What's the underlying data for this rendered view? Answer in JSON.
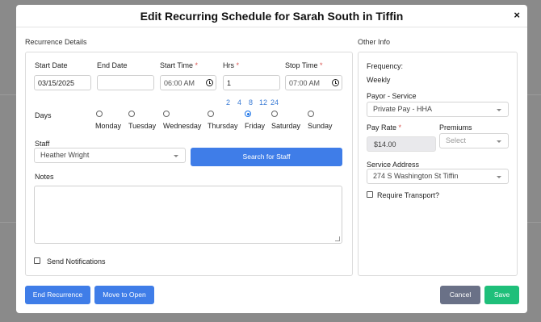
{
  "modal": {
    "title": "Edit Recurring Schedule for Sarah South in Tiffin",
    "close_label": "×"
  },
  "recurrence": {
    "section_title": "Recurrence Details",
    "start_date_label": "Start Date",
    "start_date_value": "03/15/2025",
    "end_date_label": "End Date",
    "end_date_value": "",
    "start_time_label": "Start Time",
    "start_time_value": "06:00 AM",
    "hrs_label": "Hrs",
    "hrs_value": "1",
    "stop_time_label": "Stop Time",
    "stop_time_value": "07:00 AM",
    "required_mark": "*",
    "quick_hours": [
      "2",
      "4",
      "8",
      "12",
      "24"
    ],
    "days_label": "Days",
    "days": [
      {
        "label": "Monday",
        "checked": false
      },
      {
        "label": "Tuesday",
        "checked": false
      },
      {
        "label": "Wednesday",
        "checked": false
      },
      {
        "label": "Thursday",
        "checked": false
      },
      {
        "label": "Friday",
        "checked": true
      },
      {
        "label": "Saturday",
        "checked": false
      },
      {
        "label": "Sunday",
        "checked": false
      }
    ],
    "staff_label": "Staff",
    "staff_value": "Heather Wright",
    "search_staff_label": "Search for Staff",
    "notes_label": "Notes",
    "notes_value": "",
    "send_notifications_label": "Send Notifications"
  },
  "other_info": {
    "section_title": "Other Info",
    "frequency_label": "Frequency:",
    "frequency_value": "Weekly",
    "payor_label": "Payor - Service",
    "payor_value": "Private Pay - HHA",
    "pay_rate_label": "Pay Rate",
    "pay_rate_value": "$14.00",
    "premiums_label": "Premiums",
    "premiums_placeholder": "Select",
    "service_address_label": "Service Address",
    "service_address_value": "274 S Washington St Tiffin",
    "require_transport_label": "Require Transport?"
  },
  "footer": {
    "end_recurrence_label": "End Recurrence",
    "move_to_open_label": "Move to Open",
    "cancel_label": "Cancel",
    "save_label": "Save"
  },
  "colors": {
    "primary": "#3f7de8",
    "secondary": "#6a7187",
    "success": "#1fbf7a",
    "required": "#d9534f"
  }
}
